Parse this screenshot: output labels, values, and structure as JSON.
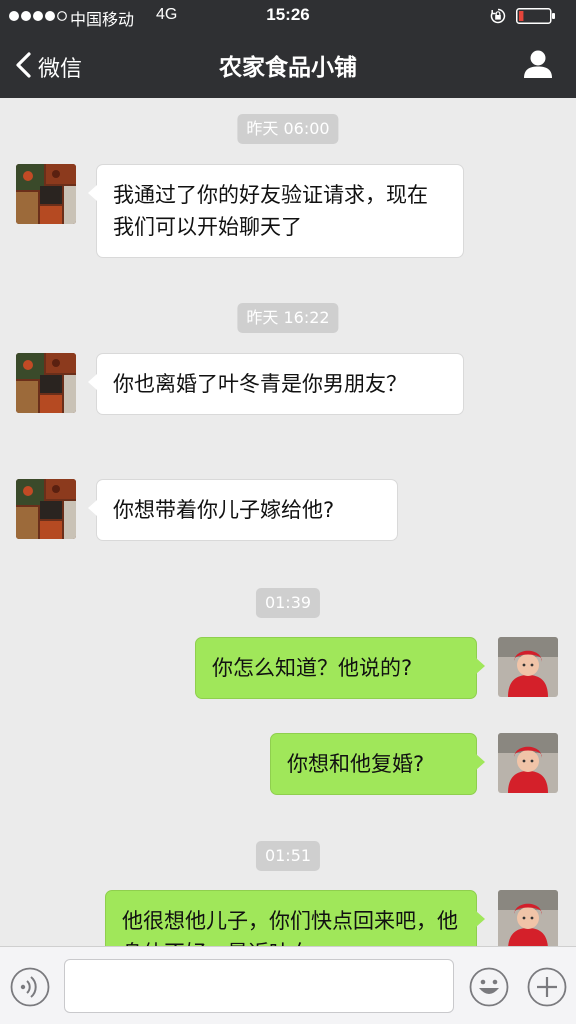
{
  "status_bar": {
    "carrier": "中国移动",
    "network": "4G",
    "time": "15:26",
    "signal_bars": 4,
    "battery_level": 0.15,
    "battery_color": "#e5453b"
  },
  "nav": {
    "back_label": "微信",
    "title": "农家食品小铺",
    "back_icon": "chevron-left-icon",
    "right_icon": "person-icon"
  },
  "chat": {
    "timestamps": [
      "昨天 06:00",
      "昨天 16:22",
      "01:39",
      "01:51"
    ],
    "messages": [
      {
        "side": "received",
        "text": "我通过了你的好友验证请求，现在我们可以开始聊天了"
      },
      {
        "side": "received",
        "text": "你也离婚了叶冬青是你男朋友？"
      },
      {
        "side": "received",
        "text": "你想带着你儿子嫁给他?"
      },
      {
        "side": "sent",
        "text": "你怎么知道？他说的?"
      },
      {
        "side": "sent",
        "text": "你想和他复婚?"
      },
      {
        "side": "sent",
        "text": "他很想他儿子，你们快点回来吧，他身体不好，最近吐血"
      }
    ],
    "colors": {
      "received_bubble": "#ffffff",
      "sent_bubble": "#a0e75a",
      "timestamp_bg": "#cfcfcf"
    }
  },
  "input_bar": {
    "placeholder": "",
    "value": "",
    "icons": [
      "voice-icon",
      "emoji-icon",
      "plus-icon"
    ]
  }
}
